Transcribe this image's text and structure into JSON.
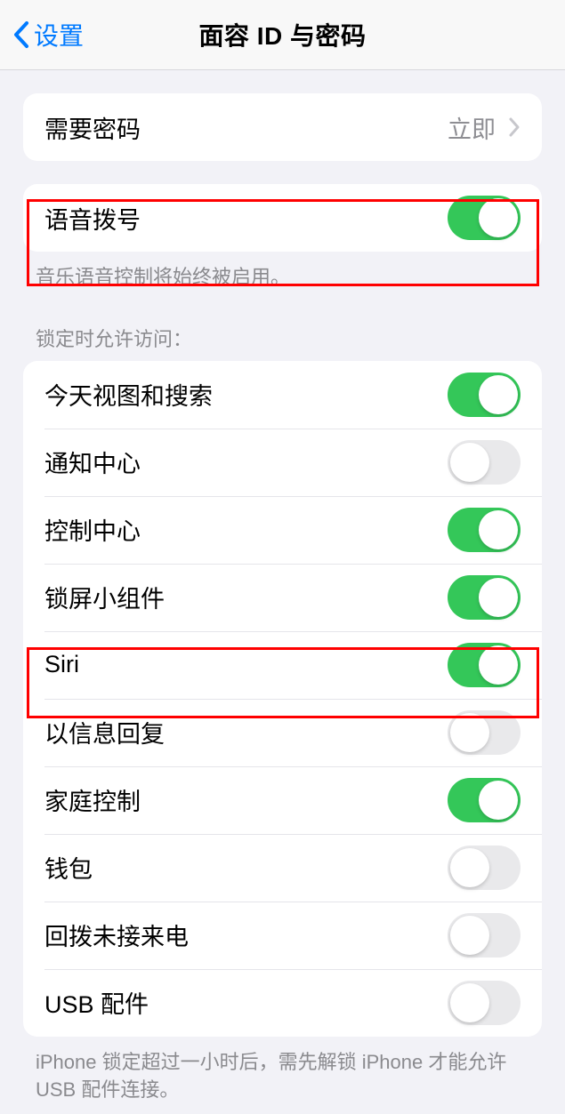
{
  "header": {
    "back_label": "设置",
    "title": "面容 ID 与密码"
  },
  "passcode": {
    "label": "需要密码",
    "value": "立即"
  },
  "voice_dial": {
    "label": "语音拨号",
    "on": true,
    "footer": "音乐语音控制将始终被启用。"
  },
  "lock_access": {
    "header": "锁定时允许访问：",
    "items": [
      {
        "label": "今天视图和搜索",
        "on": true
      },
      {
        "label": "通知中心",
        "on": false
      },
      {
        "label": "控制中心",
        "on": true
      },
      {
        "label": "锁屏小组件",
        "on": true
      },
      {
        "label": "Siri",
        "on": true
      },
      {
        "label": "以信息回复",
        "on": false
      },
      {
        "label": "家庭控制",
        "on": true
      },
      {
        "label": "钱包",
        "on": false
      },
      {
        "label": "回拨未接来电",
        "on": false
      },
      {
        "label": "USB 配件",
        "on": false
      }
    ],
    "footer": "iPhone 锁定超过一小时后，需先解锁 iPhone 才能允许 USB 配件连接。"
  }
}
